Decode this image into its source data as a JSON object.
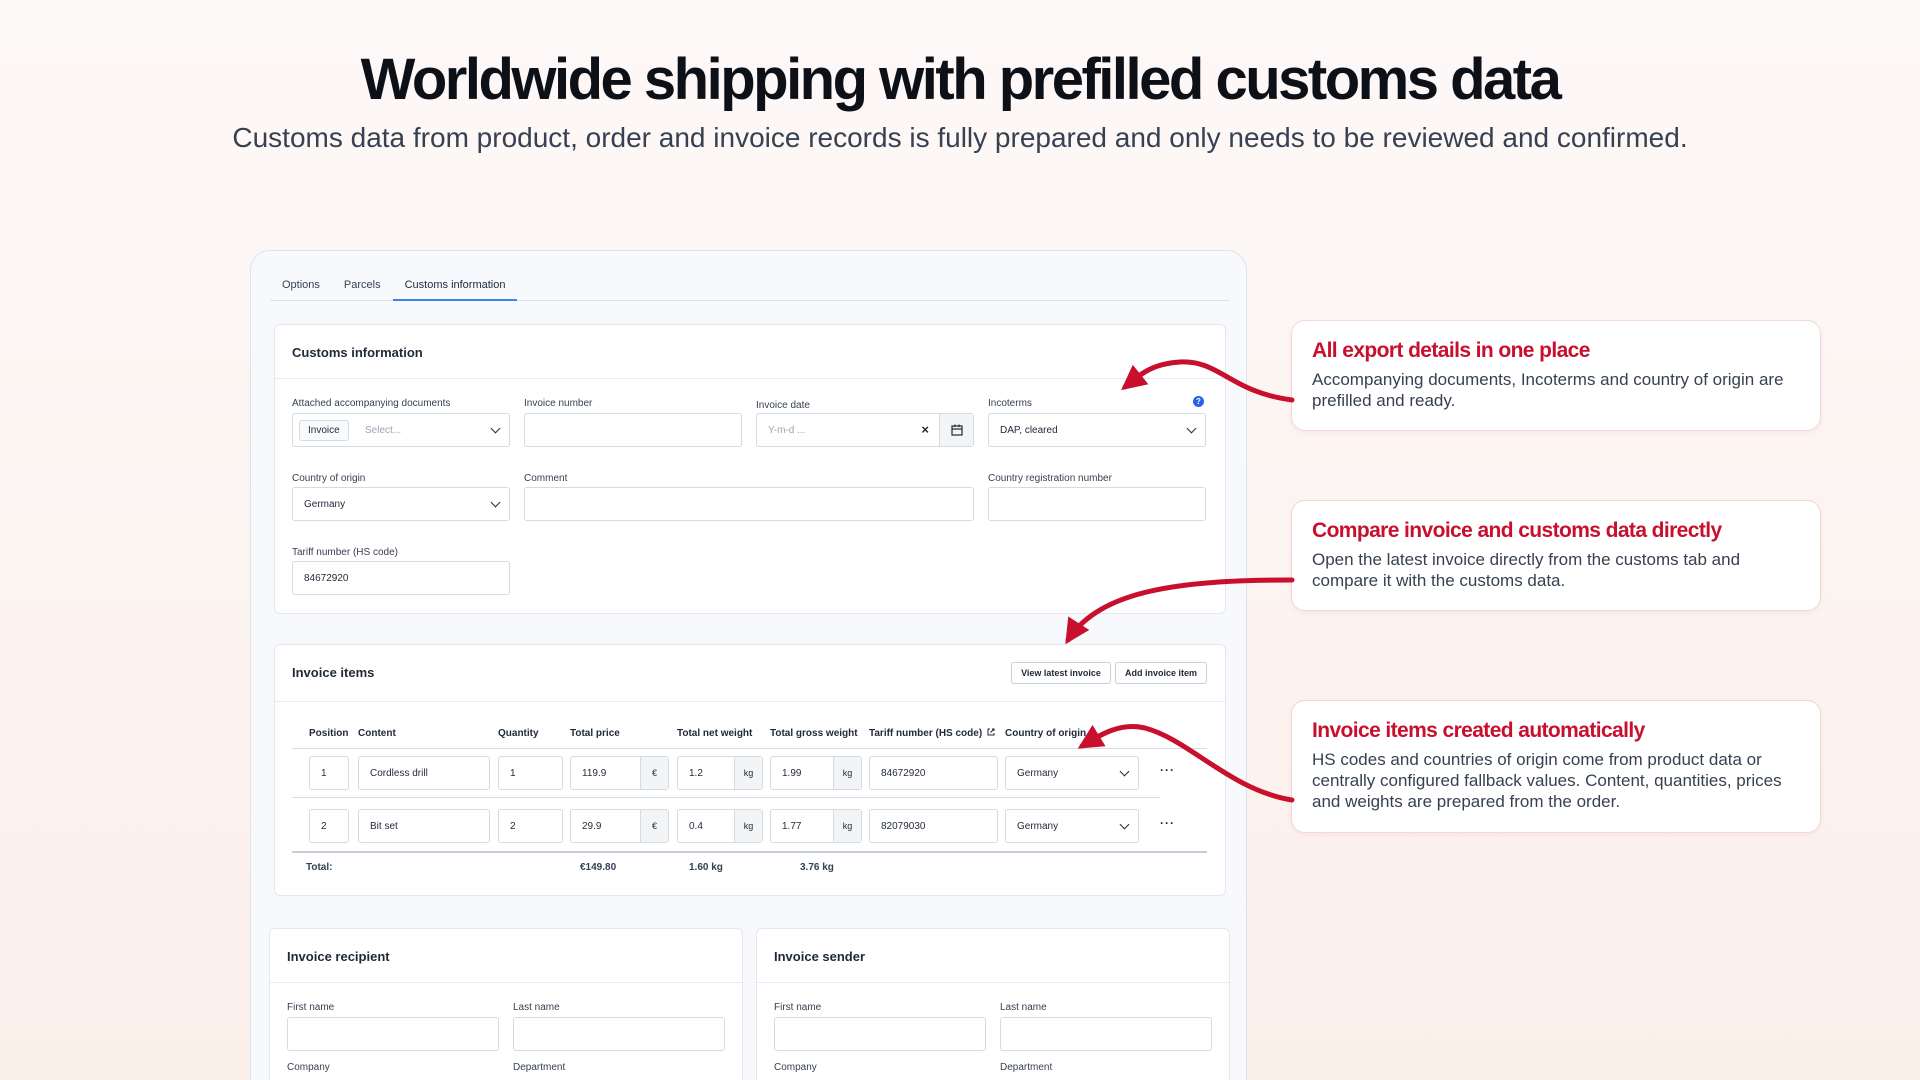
{
  "hero": {
    "title": "Worldwide shipping with prefilled customs data",
    "subtitle": "Customs data from product, order and invoice records is fully prepared and only needs to be reviewed and confirmed."
  },
  "tabs": [
    "Options",
    "Parcels",
    "Customs information"
  ],
  "customs": {
    "title": "Customs information",
    "docs_label": "Attached accompanying documents",
    "docs_chip": "Invoice",
    "docs_placeholder": "Select...",
    "invoice_number_label": "Invoice number",
    "invoice_date_label": "Invoice date",
    "invoice_date_placeholder": "Y-m-d ...",
    "incoterms_label": "Incoterms",
    "incoterms_value": "DAP, cleared",
    "info_glyph": "?",
    "origin_label": "Country of origin",
    "origin_value": "Germany",
    "comment_label": "Comment",
    "reg_label": "Country registration number",
    "tariff_label": "Tariff number (HS code)",
    "tariff_value": "84672920"
  },
  "invoice_items": {
    "title": "Invoice items",
    "view_latest_btn": "View latest invoice",
    "add_item_btn": "Add invoice item",
    "headers": {
      "position": "Position",
      "content": "Content",
      "quantity": "Quantity",
      "total_price": "Total price",
      "net_weight": "Total net weight",
      "gross_weight": "Total gross weight",
      "tariff": "Tariff number (HS code)",
      "country": "Country of origin"
    },
    "rows": [
      {
        "position": "1",
        "content": "Cordless drill",
        "quantity": "1",
        "price": "119.9",
        "currency": "€",
        "net": "1.2",
        "net_unit": "kg",
        "gross": "1.99",
        "gross_unit": "kg",
        "tariff": "84672920",
        "country": "Germany",
        "more": "···"
      },
      {
        "position": "2",
        "content": "Bit set",
        "quantity": "2",
        "price": "29.9",
        "currency": "€",
        "net": "0.4",
        "net_unit": "kg",
        "gross": "1.77",
        "gross_unit": "kg",
        "tariff": "82079030",
        "country": "Germany",
        "more": "···"
      }
    ],
    "totals": {
      "label": "Total:",
      "price": "€149.80",
      "net": "1.60 kg",
      "gross": "3.76 kg"
    }
  },
  "recipient": {
    "title": "Invoice recipient",
    "first_name": "First name",
    "last_name": "Last name",
    "company": "Company",
    "department": "Department"
  },
  "sender": {
    "title": "Invoice sender",
    "first_name": "First name",
    "last_name": "Last name",
    "company": "Company",
    "department": "Department"
  },
  "callouts": [
    {
      "title": "All export details in one place",
      "text": "Accompanying documents, Incoterms and country of origin are prefilled and ready."
    },
    {
      "title": "Compare invoice and customs data directly",
      "text": "Open the latest invoice directly from the customs tab and compare it with the customs data."
    },
    {
      "title": "Invoice items created automatically",
      "text": "HS codes and countries of origin come from product data or centrally configured fallback values. Content, quantities, prices and weights are prepared from the order."
    }
  ],
  "colors": {
    "accent": "#c8102e",
    "tab_active": "#3b82f6",
    "info": "#2563eb"
  }
}
